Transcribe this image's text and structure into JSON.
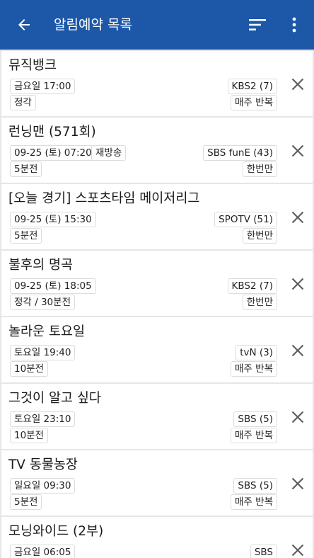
{
  "appbar": {
    "title": "알림예약 목록",
    "background": "#1c57a8",
    "icons": [
      "back-arrow-icon",
      "sort-icon",
      "more-vert-icon"
    ]
  },
  "reservations": [
    {
      "title": "뮤직뱅크",
      "date_time": "금요일 17:00",
      "rerun": "",
      "channel": "KBS2 (7)",
      "notify": "정각",
      "repeat": "매주 반복"
    },
    {
      "title": "런닝맨 (571회)",
      "date_time": "09-25 (토) 07:20",
      "rerun": "재방송",
      "channel": "SBS funE (43)",
      "notify": "5분전",
      "repeat": "한번만"
    },
    {
      "title": "[오늘 경기] 스포츠타임 메이저리그",
      "date_time": "09-25 (토) 15:30",
      "rerun": "",
      "channel": "SPOTV (51)",
      "notify": "5분전",
      "repeat": "한번만"
    },
    {
      "title": "불후의 명곡",
      "date_time": "09-25 (토) 18:05",
      "rerun": "",
      "channel": "KBS2 (7)",
      "notify": "정각 / 30분전",
      "repeat": "한번만"
    },
    {
      "title": "놀라운 토요일",
      "date_time": "토요일 19:40",
      "rerun": "",
      "channel": "tvN (3)",
      "notify": "10분전",
      "repeat": "매주 반복"
    },
    {
      "title": "그것이 알고 싶다",
      "date_time": "토요일 23:10",
      "rerun": "",
      "channel": "SBS (5)",
      "notify": "10분전",
      "repeat": "매주 반복"
    },
    {
      "title": "TV 동물농장",
      "date_time": "일요일 09:30",
      "rerun": "",
      "channel": "SBS (5)",
      "notify": "5분전",
      "repeat": "매주 반복"
    },
    {
      "title": "모닝와이드 (2부)",
      "date_time": "금요일 06:05",
      "rerun": "",
      "channel": "SBS",
      "notify": "",
      "repeat": ""
    }
  ]
}
